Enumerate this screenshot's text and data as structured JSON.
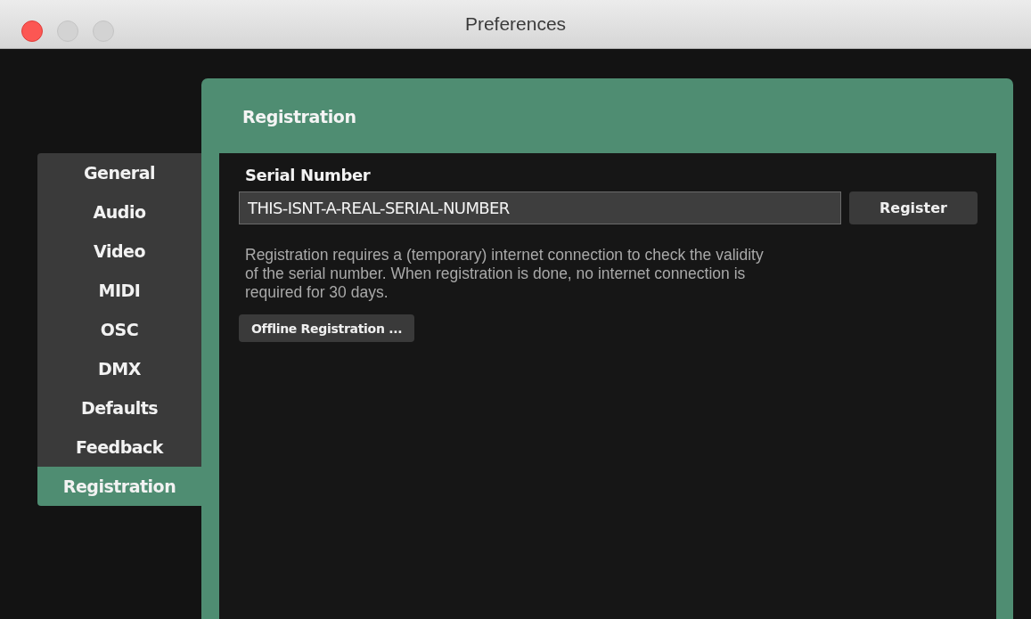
{
  "window": {
    "title": "Preferences"
  },
  "sidebar": {
    "items": [
      {
        "label": "General",
        "selected": false
      },
      {
        "label": "Audio",
        "selected": false
      },
      {
        "label": "Video",
        "selected": false
      },
      {
        "label": "MIDI",
        "selected": false
      },
      {
        "label": "OSC",
        "selected": false
      },
      {
        "label": "DMX",
        "selected": false
      },
      {
        "label": "Defaults",
        "selected": false
      },
      {
        "label": "Feedback",
        "selected": false
      },
      {
        "label": "Registration",
        "selected": true
      }
    ]
  },
  "panel": {
    "title": "Registration",
    "serial_label": "Serial Number",
    "serial_value": "THIS-ISNT-A-REAL-SERIAL-NUMBER",
    "register_button": "Register",
    "description": "Registration requires a (temporary) internet connection to check the validity of the serial number. When registration is done, no internet connection is required for 30 days.",
    "offline_button": "Offline Registration ..."
  }
}
